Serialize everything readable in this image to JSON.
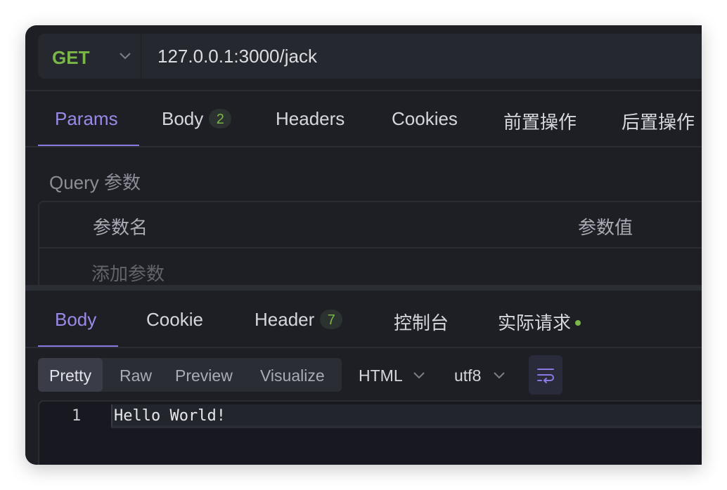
{
  "request": {
    "method": "GET",
    "url": "127.0.0.1:3000/jack"
  },
  "request_tabs": [
    {
      "label": "Params",
      "active": true
    },
    {
      "label": "Body",
      "badge": "2"
    },
    {
      "label": "Headers"
    },
    {
      "label": "Cookies"
    },
    {
      "label": "前置操作"
    },
    {
      "label": "后置操作"
    }
  ],
  "params": {
    "section_title": "Query 参数",
    "col_name": "参数名",
    "col_value": "参数值",
    "add_placeholder": "添加参数"
  },
  "response_tabs": [
    {
      "label": "Body",
      "active": true
    },
    {
      "label": "Cookie"
    },
    {
      "label": "Header",
      "badge": "7"
    },
    {
      "label": "控制台"
    },
    {
      "label": "实际请求"
    }
  ],
  "view_modes": [
    "Pretty",
    "Raw",
    "Preview",
    "Visualize"
  ],
  "selected_view_mode": "Pretty",
  "format": "HTML",
  "encoding": "utf8",
  "response_body": {
    "line_numbers": [
      "1"
    ],
    "lines": [
      "Hello World!"
    ]
  },
  "colors": {
    "accent": "#8a79e2",
    "method_get": "#7ab648",
    "background": "#1e1f25"
  },
  "icons": {
    "method_dropdown": "chevron-down-icon",
    "wrap_toggle": "wrap-lines-icon",
    "status_dot": "green-dot-icon"
  }
}
